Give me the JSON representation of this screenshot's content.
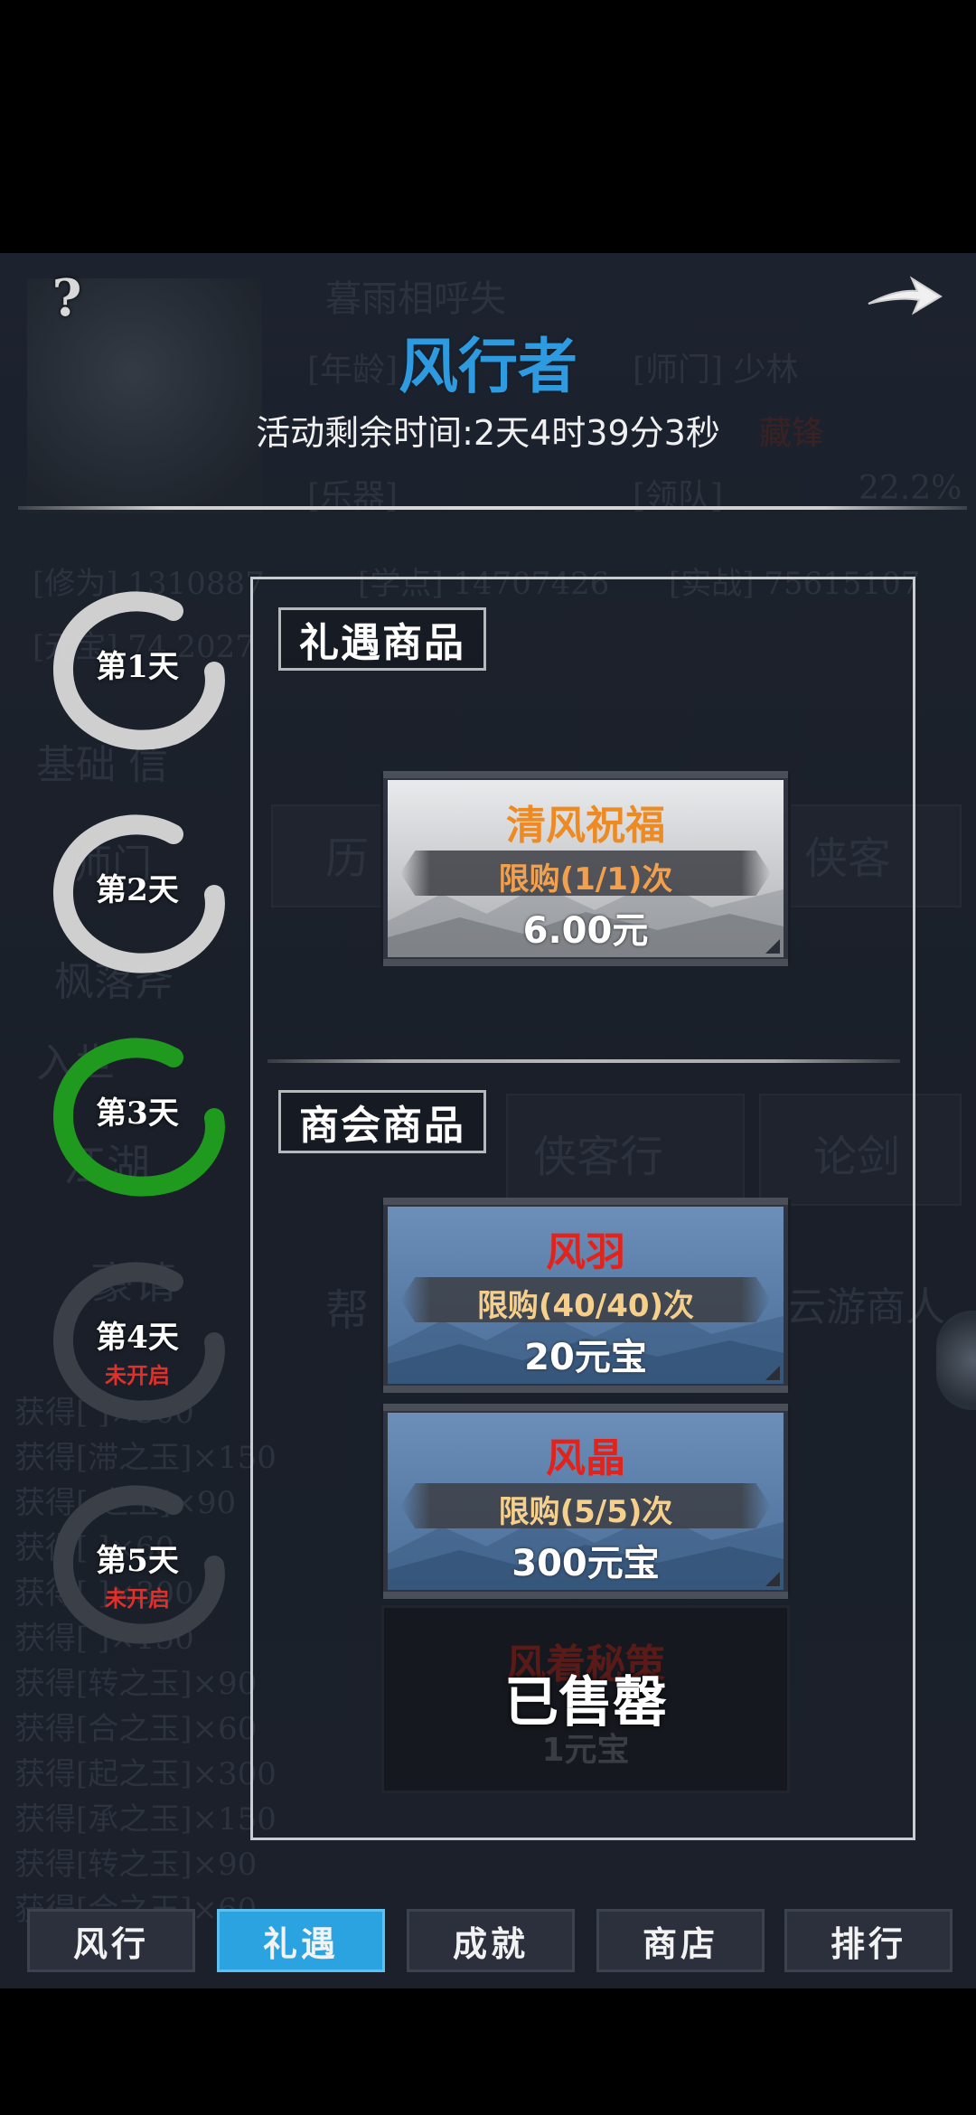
{
  "header": {
    "title": "风行者",
    "timer": "活动剩余时间:2天4时39分3秒",
    "help_glyph": "?"
  },
  "background_text": {
    "name": "暮雨相呼失",
    "age": "[年龄]",
    "sect": "[师门] 少林",
    "rank": "藏锋",
    "spouse": "[乐器]",
    "team": "[领队]",
    "percent": "22.2%",
    "cultivation": "[修为] 1310887",
    "xue": "[学点] 14707426",
    "shi": "[实战] 75615107",
    "row2": "[元宝] 74   2027",
    "base": "基础   信",
    "li": "历",
    "xiake": "侠客",
    "shimen": "师门",
    "ma": "枫落斧",
    "rushi": "入世",
    "jianghu": "江湖",
    "xiakehang": "侠客行",
    "lunjian": "论剑",
    "haoqing": "豪请",
    "bang": "帮",
    "yunyou": "云游商人",
    "gets": [
      "获得[ ]×300",
      "获得[滞之玉]×150",
      "获得[ 之玉]×90",
      "获得[ ]×60",
      "获得[ ]×300",
      "获得[ ]×150",
      "获得[转之玉]×90",
      "获得[合之玉]×60",
      "获得[起之玉]×300",
      "获得[承之玉]×150",
      "获得[转之玉]×90",
      "获得[合之玉]×60"
    ]
  },
  "days": [
    {
      "label": "第1天",
      "sub": "",
      "state": "done",
      "color": "#d9d9d9"
    },
    {
      "label": "第2天",
      "sub": "",
      "state": "done",
      "color": "#d9d9d9"
    },
    {
      "label": "第3天",
      "sub": "",
      "state": "current",
      "color": "#1f9a1f"
    },
    {
      "label": "第4天",
      "sub": "未开启",
      "state": "locked",
      "color": "#3a3f48"
    },
    {
      "label": "第5天",
      "sub": "未开启",
      "state": "locked",
      "color": "#3a3f48"
    }
  ],
  "sections": {
    "gift_title": "礼遇商品",
    "guild_title": "商会商品"
  },
  "gift_items": [
    {
      "name": "清风祝福",
      "limit": "限购(1/1)次",
      "price": "6.00元"
    }
  ],
  "guild_items": [
    {
      "name": "风羽",
      "limit": "限购(40/40)次",
      "price": "20元宝"
    },
    {
      "name": "风晶",
      "limit": "限购(5/5)次",
      "price": "300元宝"
    }
  ],
  "sold_item": {
    "name": "风着秘策",
    "price": "1元宝",
    "status": "已售罄"
  },
  "tabs": [
    {
      "label": "风行",
      "active": false
    },
    {
      "label": "礼遇",
      "active": true
    },
    {
      "label": "成就",
      "active": false
    },
    {
      "label": "商店",
      "active": false
    },
    {
      "label": "排行",
      "active": false
    }
  ],
  "colors": {
    "title": "#2e9be0",
    "tab_active": "#2aa3e0",
    "card_name_orange": "#ee8a22",
    "card_name_red": "#e2231c",
    "limit_orange": "#f3a04d",
    "locked_red": "#e0302a",
    "current_green": "#1f9a1f"
  },
  "icons": [
    "help-icon",
    "arrow-right-icon"
  ]
}
